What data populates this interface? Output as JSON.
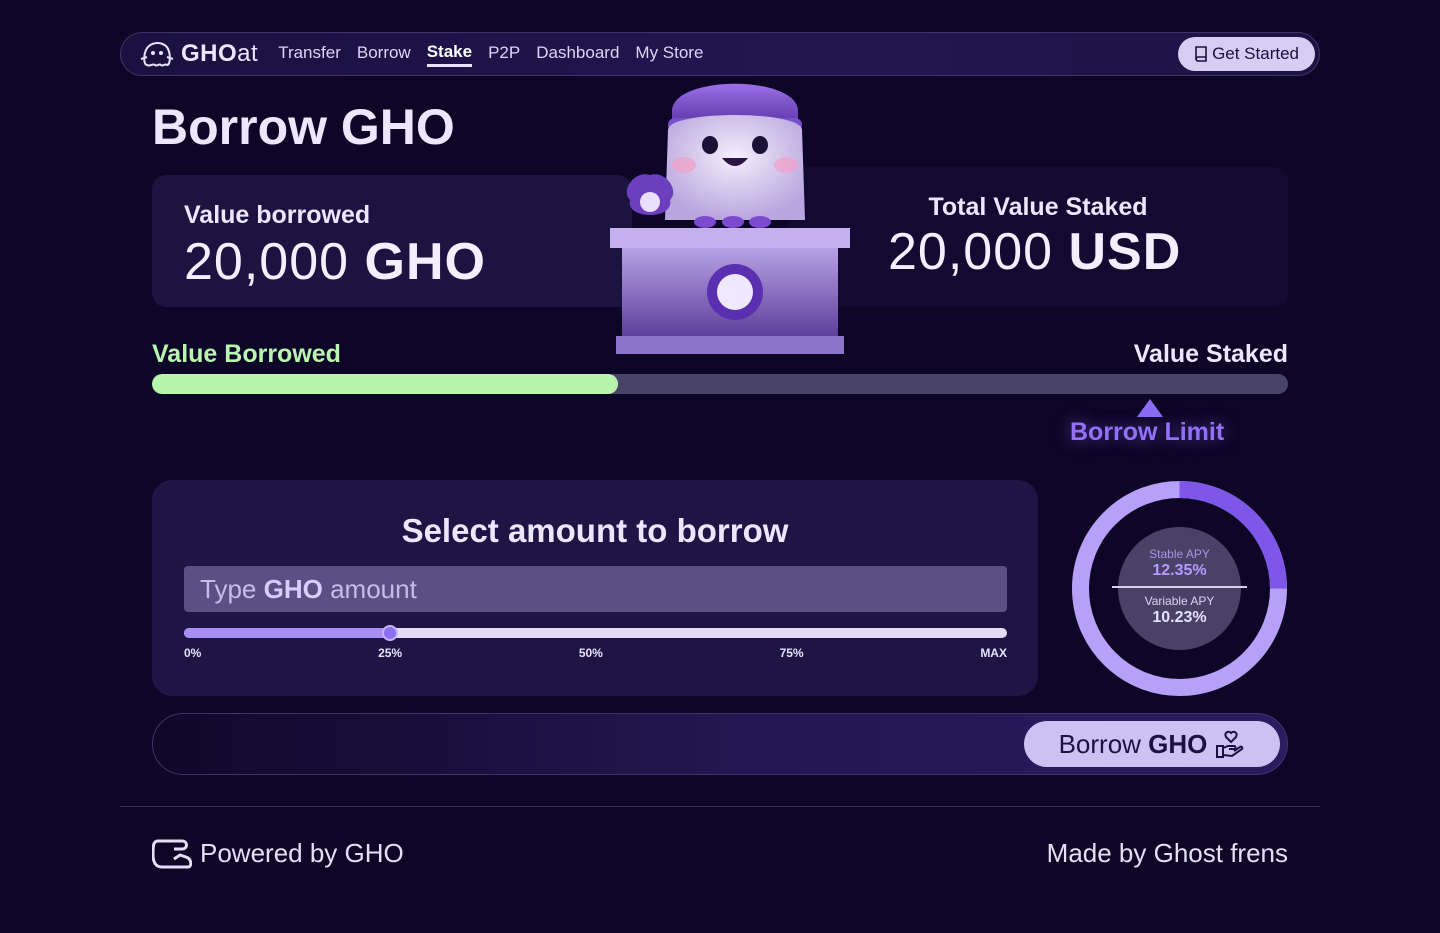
{
  "nav": {
    "brand_bold": "GHO",
    "brand_light": "at",
    "links": [
      "Transfer",
      "Borrow",
      "Stake",
      "P2P",
      "Dashboard",
      "My Store"
    ],
    "active": "Stake",
    "cta_label": "Get Started"
  },
  "page": {
    "title": "Borrow GHO"
  },
  "borrowed": {
    "label": "Value borrowed",
    "amount": "20,000",
    "unit": "GHO"
  },
  "staked": {
    "label": "Total Value Staked",
    "amount": "20,000",
    "unit": "USD"
  },
  "progress": {
    "left_label": "Value Borrowed",
    "right_label": "Value Staked",
    "fill_fraction": 0.41,
    "limit_label": "Borrow Limit",
    "limit_fraction": 0.88
  },
  "select": {
    "title": "Select amount to borrow",
    "placeholder_pre": "Type",
    "placeholder_bold": "GHO",
    "placeholder_post": "amount",
    "slider_fraction": 0.25,
    "ticks": [
      "0%",
      "25%",
      "50%",
      "75%",
      "MAX"
    ]
  },
  "apy": {
    "stable_label": "Stable APY",
    "stable_value": "12.35%",
    "variable_label": "Variable APY",
    "variable_value": "10.23%",
    "ring_fraction": 0.25
  },
  "action": {
    "button_pre": "Borrow",
    "button_bold": "GHO"
  },
  "footer": {
    "left": "Powered by GHO",
    "right": "Made by Ghost frens"
  },
  "colors": {
    "accent": "#8b6cf2",
    "borrowed": "#b7f5ad",
    "bg": "#0e0627"
  }
}
